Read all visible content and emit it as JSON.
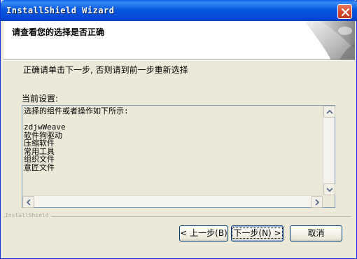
{
  "window": {
    "title": "InstallShield Wizard"
  },
  "header": {
    "title": "请查看您的选择是否正确"
  },
  "body": {
    "instruction": "正确请单击下一步, 否则请到前一步重新选择",
    "settings_label": "当前设置:",
    "settings_text": "选择的组件或者操作如下所示:\n\nzdjwWeave\n软件狗驱动\n压缩软件\n常用工具\n组织文件\n意匠文件"
  },
  "footer": {
    "brand": "InstallShield",
    "back_label": "< 上一步(B)",
    "next_label": "下一步(N) >",
    "cancel_label": "取消"
  },
  "colors": {
    "title_bar": "#0a5fe8",
    "close_button": "#d2452a",
    "dialog_bg": "#ece9d8"
  },
  "icons": {
    "close": "close-x-icon",
    "scroll_up": "arrow-up-icon",
    "scroll_down": "arrow-down-icon",
    "scroll_left": "arrow-left-icon",
    "scroll_right": "arrow-right-icon"
  }
}
